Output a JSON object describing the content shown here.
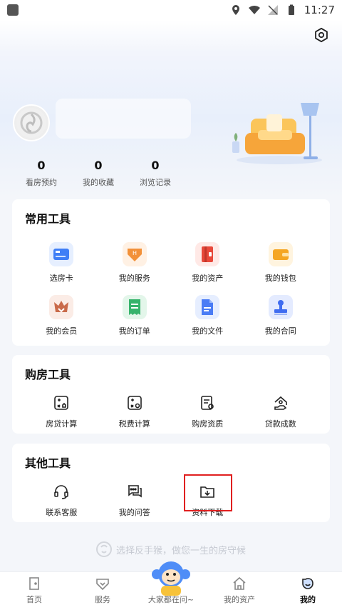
{
  "status_bar": {
    "time": "11:27"
  },
  "profile": {
    "stats": [
      {
        "value": "0",
        "label": "看房预约"
      },
      {
        "value": "0",
        "label": "我的收藏"
      },
      {
        "value": "0",
        "label": "浏览记录"
      }
    ]
  },
  "common_tools": {
    "title": "常用工具",
    "items": [
      {
        "label": "选房卡",
        "icon": "card-icon",
        "color": "#3f7ef6"
      },
      {
        "label": "我的服务",
        "icon": "service-h-icon",
        "color": "#f2913a"
      },
      {
        "label": "我的资产",
        "icon": "asset-icon",
        "color": "#e8483a"
      },
      {
        "label": "我的钱包",
        "icon": "wallet-icon",
        "color": "#f5a623"
      },
      {
        "label": "我的会员",
        "icon": "crown-icon",
        "color": "#c96a4a"
      },
      {
        "label": "我的订单",
        "icon": "order-icon",
        "color": "#36b36b"
      },
      {
        "label": "我的文件",
        "icon": "file-icon",
        "color": "#4a7cf5"
      },
      {
        "label": "我的合同",
        "icon": "stamp-icon",
        "color": "#3f6cf0"
      }
    ]
  },
  "buy_tools": {
    "title": "购房工具",
    "items": [
      {
        "label": "房贷计算",
        "icon": "mortgage-calc-icon"
      },
      {
        "label": "税费计算",
        "icon": "tax-calc-icon"
      },
      {
        "label": "购房资质",
        "icon": "qualification-icon"
      },
      {
        "label": "贷款成数",
        "icon": "loan-ratio-icon"
      }
    ]
  },
  "other_tools": {
    "title": "其他工具",
    "items": [
      {
        "label": "联系客服",
        "icon": "headset-icon"
      },
      {
        "label": "我的问答",
        "icon": "chat-icon"
      },
      {
        "label": "资料下载",
        "icon": "download-folder-icon"
      }
    ]
  },
  "slogan": "选择反手猴，做您一生的房守候",
  "tabbar": {
    "items": [
      {
        "label": "首页",
        "icon": "home-door-icon",
        "active": false
      },
      {
        "label": "服务",
        "icon": "service-tag-icon",
        "active": false
      },
      {
        "label": "大家都在问~",
        "icon": "monkey-mascot-icon",
        "active": false
      },
      {
        "label": "我的资产",
        "icon": "house-icon",
        "active": false
      },
      {
        "label": "我的",
        "icon": "smile-face-icon",
        "active": true
      }
    ]
  }
}
